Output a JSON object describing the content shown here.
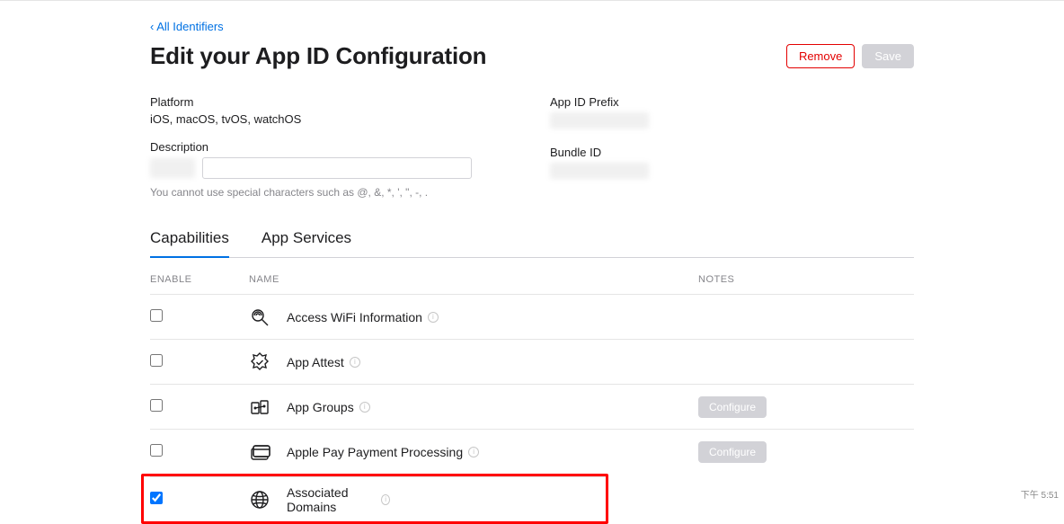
{
  "nav": {
    "back_label": "All Identifiers"
  },
  "header": {
    "title": "Edit your App ID Configuration",
    "remove_label": "Remove",
    "save_label": "Save"
  },
  "meta": {
    "platform_label": "Platform",
    "platform_value": "iOS, macOS, tvOS, watchOS",
    "prefix_label": "App ID Prefix",
    "description_label": "Description",
    "bundle_label": "Bundle ID",
    "hint": "You cannot use special characters such as @, &, *, ', \", -, ."
  },
  "tabs": {
    "capabilities": "Capabilities",
    "app_services": "App Services"
  },
  "table": {
    "head_enable": "ENABLE",
    "head_name": "NAME",
    "head_notes": "NOTES",
    "configure_label": "Configure",
    "rows": [
      {
        "name": "Access WiFi Information",
        "checked": false,
        "configure": false,
        "icon": "wifi-search"
      },
      {
        "name": "App Attest",
        "checked": false,
        "configure": false,
        "icon": "attest"
      },
      {
        "name": "App Groups",
        "checked": false,
        "configure": true,
        "icon": "groups"
      },
      {
        "name": "Apple Pay Payment Processing",
        "checked": false,
        "configure": true,
        "icon": "pay"
      },
      {
        "name": "Associated Domains",
        "checked": true,
        "configure": false,
        "icon": "globe",
        "highlight": true
      }
    ]
  },
  "footer": {
    "time": "下午 5:51"
  }
}
